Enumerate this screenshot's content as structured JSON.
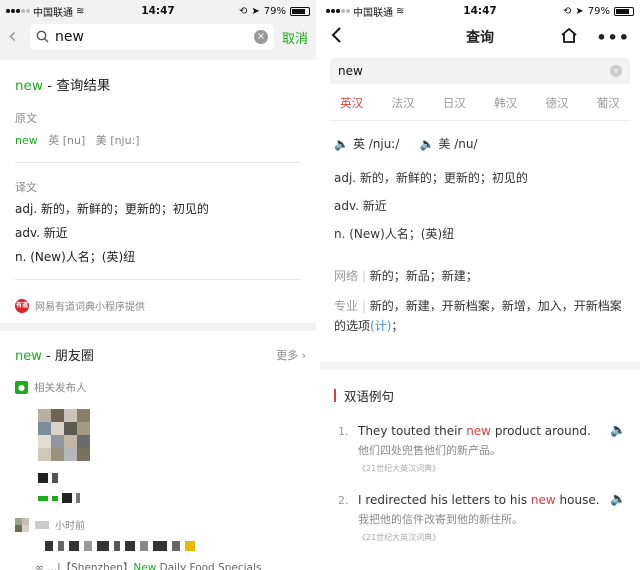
{
  "status_bar": {
    "carrier": "中国联通",
    "time": "14:47",
    "battery": "79%"
  },
  "left": {
    "search_value": "new",
    "cancel": "取消",
    "result_title": {
      "keyword": "new",
      "suffix": " - 查询结果"
    },
    "original_label": "原文",
    "original": {
      "word": "new",
      "uk": "英 [nu]",
      "us": "美 [nju:]"
    },
    "translation_label": "译文",
    "definitions": [
      "adj. 新的，新鲜的；更新的；初见的",
      "adv. 新近",
      "n. (New)人名；(英)纽"
    ],
    "provider": "网易有道词典小程序提供",
    "provider_badge": "有道",
    "moments_title": {
      "keyword": "new",
      "suffix": " - 朋友圈"
    },
    "more": "更多",
    "related_publisher": "相关发布人",
    "post_time": "小时前",
    "link_text": {
      "prefix": "...|【Shenzhen】",
      "keyword": "New",
      "suffix": " Daily Food Specials"
    }
  },
  "right": {
    "title": "查询",
    "search_value": "new",
    "lang_tabs": [
      "英汉",
      "法汉",
      "日汉",
      "韩汉",
      "德汉",
      "葡汉"
    ],
    "phonetic_uk": "英 /njuː/",
    "phonetic_us": "美 /nu/",
    "definitions": [
      "adj. 新的，新鲜的；更新的；初见的",
      "adv. 新近",
      "n. (New)人名；(英)纽"
    ],
    "web_label": "网络",
    "web_text": "新的；新品；新建；",
    "pro_label": "专业",
    "pro_text": "新的，新建，开新档案，新增，加入，开新档案的选项",
    "pro_link": "(计)",
    "pro_end": "；",
    "bilingual_title": "双语例句",
    "examples": [
      {
        "num": "1.",
        "en_pre": "They touted their ",
        "hl": "new",
        "en_post": " product around.",
        "zh": "他们四处兜售他们的新产品。",
        "src": "《21世纪大英汉词典》"
      },
      {
        "num": "2.",
        "en_pre": "I redirected his letters to his ",
        "hl": "new",
        "en_post": " house.",
        "zh": "我把他的信件改寄到他的新住所。",
        "src": "《21世纪大英汉词典》"
      }
    ]
  }
}
